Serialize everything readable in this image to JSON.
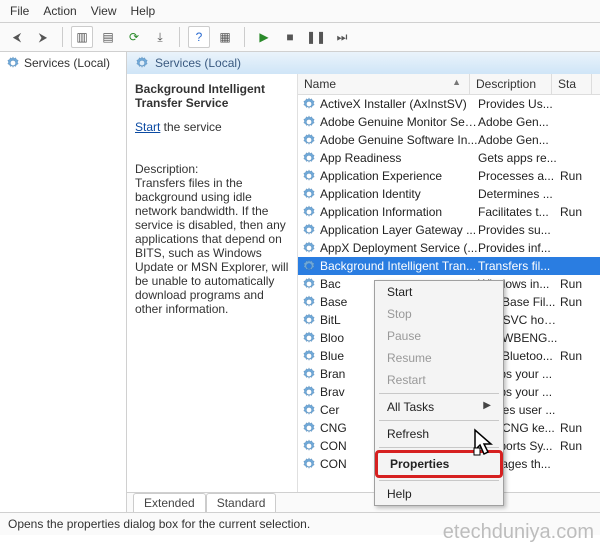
{
  "menu": {
    "file": "File",
    "action": "Action",
    "view": "View",
    "help": "Help"
  },
  "tree": {
    "root": "Services (Local)"
  },
  "header": {
    "title": "Services (Local)"
  },
  "detail": {
    "name": "Background Intelligent Transfer Service",
    "start_label": "Start",
    "start_suffix": " the service",
    "desc_label": "Description:",
    "desc": "Transfers files in the background using idle network bandwidth. If the service is disabled, then any applications that depend on BITS, such as Windows Update or MSN Explorer, will be unable to automatically download programs and other information."
  },
  "cols": {
    "name": "Name",
    "desc": "Description",
    "status": "Sta"
  },
  "services": [
    {
      "name": "ActiveX Installer (AxInstSV)",
      "desc": "Provides Us...",
      "status": ""
    },
    {
      "name": "Adobe Genuine Monitor Ser...",
      "desc": "Adobe Gen...",
      "status": ""
    },
    {
      "name": "Adobe Genuine Software In...",
      "desc": "Adobe Gen...",
      "status": ""
    },
    {
      "name": "App Readiness",
      "desc": "Gets apps re...",
      "status": ""
    },
    {
      "name": "Application Experience",
      "desc": "Processes a...",
      "status": "Run"
    },
    {
      "name": "Application Identity",
      "desc": "Determines ...",
      "status": ""
    },
    {
      "name": "Application Information",
      "desc": "Facilitates t...",
      "status": "Run"
    },
    {
      "name": "Application Layer Gateway ...",
      "desc": "Provides su...",
      "status": ""
    },
    {
      "name": "AppX Deployment Service (...",
      "desc": "Provides inf...",
      "status": ""
    },
    {
      "name": "Background Intelligent Tran...",
      "desc": "Transfers fil...",
      "status": "",
      "selected": true
    },
    {
      "name": "Bac",
      "desc": "Windows in...",
      "status": "Run"
    },
    {
      "name": "Base",
      "desc": "The Base Fil...",
      "status": "Run"
    },
    {
      "name": "BitL",
      "desc": "BDESVC hos...",
      "status": ""
    },
    {
      "name": "Bloo",
      "desc": "The WBENG...",
      "status": ""
    },
    {
      "name": "Blue",
      "desc": "The Bluetoo...",
      "status": "Run"
    },
    {
      "name": "Bran",
      "desc": "Keeps your ...",
      "status": ""
    },
    {
      "name": "Brav",
      "desc": "Keeps your ...",
      "status": ""
    },
    {
      "name": "Cer",
      "desc": "Copies user ...",
      "status": ""
    },
    {
      "name": "CNG",
      "desc": "The CNG ke...",
      "status": "Run"
    },
    {
      "name": "CON",
      "desc": "Supports Sy...",
      "status": "Run"
    },
    {
      "name": "CON",
      "desc": "Manages th...",
      "status": ""
    }
  ],
  "tabs": {
    "extended": "Extended",
    "standard": "Standard"
  },
  "statusbar": "Opens the properties dialog box for the current selection.",
  "context": {
    "start": "Start",
    "stop": "Stop",
    "pause": "Pause",
    "resume": "Resume",
    "restart": "Restart",
    "alltasks": "All Tasks",
    "refresh": "Refresh",
    "properties": "Properties",
    "help": "Help"
  },
  "watermark": "etechduniya.com"
}
